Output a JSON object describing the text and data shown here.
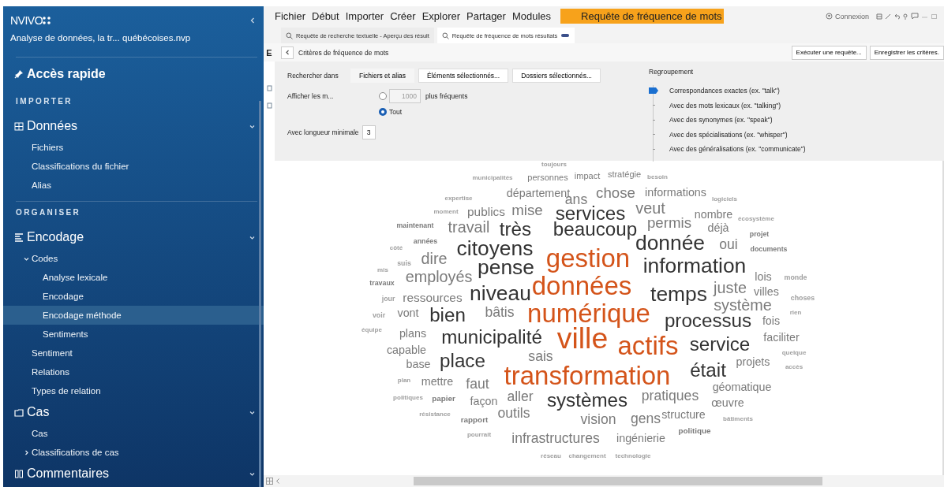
{
  "sidebar": {
    "logo": "NVIVO",
    "project": "Analyse de données, la tr... québécoises.nvp",
    "quick_access": "Accès rapide",
    "sections": [
      {
        "label": "IMPORTER",
        "groups": [
          {
            "label": "Données",
            "expanded": true,
            "children": [
              {
                "label": "Fichiers",
                "selected": false
              },
              {
                "label": "Classifications du fichier",
                "selected": false
              },
              {
                "label": "Alias",
                "selected": false
              }
            ]
          }
        ]
      },
      {
        "label": "ORGANISER",
        "groups": [
          {
            "label": "Encodage",
            "expanded": true,
            "children": [
              {
                "label": "Codes",
                "selected": false,
                "expanded": true,
                "children": [
                  {
                    "label": "Analyse lexicale",
                    "selected": false
                  },
                  {
                    "label": "Encodage",
                    "selected": false
                  },
                  {
                    "label": "Encodage méthode",
                    "selected": true
                  },
                  {
                    "label": "Sentiments",
                    "selected": false
                  }
                ]
              },
              {
                "label": "Sentiment",
                "selected": false
              },
              {
                "label": "Relations",
                "selected": false
              },
              {
                "label": "Types de relation",
                "selected": false
              }
            ]
          },
          {
            "label": "Cas",
            "expanded": true,
            "children": [
              {
                "label": "Cas",
                "selected": false
              },
              {
                "label": "Classifications de cas",
                "selected": false,
                "expanded": false
              }
            ]
          },
          {
            "label": "Commentaires",
            "expanded": true
          }
        ]
      }
    ]
  },
  "menu": [
    {
      "label": "Fichier",
      "kind": "menu"
    },
    {
      "label": "Début",
      "kind": "menu"
    },
    {
      "label": "Importer",
      "kind": "menu"
    },
    {
      "label": "Créer",
      "kind": "menu"
    },
    {
      "label": "Explorer",
      "kind": "menu"
    },
    {
      "label": "Partager",
      "kind": "menu"
    },
    {
      "label": "Modules",
      "kind": "menu"
    },
    {
      "label": "Requête de fréquence de mots",
      "kind": "context"
    }
  ],
  "account": {
    "label": "Connexion"
  },
  "doc_tabs": [
    {
      "label": "Requête de recherche textuelle - Aperçu des résult",
      "selected": false
    },
    {
      "label": "Requête de fréquence de mots résultats",
      "selected": true
    }
  ],
  "left_edge": {
    "label": "E"
  },
  "criteria_bar": {
    "title": "Critères de fréquence de mots",
    "expanded": true,
    "buttons": [
      "Exécuter une requête...",
      "Enregistrer les critères."
    ]
  },
  "criteria": {
    "search_in": {
      "label": "Rechercher dans",
      "options": [
        {
          "label": "Fichiers et alias",
          "selected": true
        },
        {
          "label": "Éléments sélectionnés...",
          "selected": false
        },
        {
          "label": "Dossiers sélectionnés...",
          "selected": false
        }
      ]
    },
    "display": {
      "label": "Afficher les m...",
      "options": [
        {
          "kind": "count",
          "checked": false,
          "value": "1000",
          "disabled": true,
          "suffix": "plus fréquents"
        },
        {
          "kind": "all",
          "checked": true,
          "label": "Tout"
        }
      ]
    },
    "min_length": {
      "label": "Avec longueur minimale",
      "value": "3"
    },
    "grouping": {
      "label": "Regroupement",
      "options": [
        {
          "label": "Correspondances exactes (ex. \"talk\")",
          "selected": true
        },
        {
          "label": "Avec des mots lexicaux (ex. \"talking\")",
          "selected": false
        },
        {
          "label": "Avec des synonymes (ex. \"speak\")",
          "selected": false
        },
        {
          "label": "Avec des spécialisations (ex. \"whisper\")",
          "selected": false
        },
        {
          "label": "Avec des généralisations (ex. \"communicate\")",
          "selected": false
        }
      ]
    }
  },
  "word_cloud": {
    "words": [
      {
        "text": "toujours",
        "color": "#a0a0a0"
      },
      {
        "text": "municipalités",
        "color": "#a0a0a0"
      },
      {
        "text": "personnes",
        "color": "#7a7a7a"
      },
      {
        "text": "impact",
        "color": "#7a7a7a"
      },
      {
        "text": "stratégie",
        "color": "#7a7a7a"
      },
      {
        "text": "besoin",
        "color": "#a0a0a0"
      },
      {
        "text": "expertise",
        "color": "#a0a0a0"
      },
      {
        "text": "département",
        "color": "#7a7a7a"
      },
      {
        "text": "ans",
        "color": "#7a7a7a"
      },
      {
        "text": "chose",
        "color": "#7a7a7a"
      },
      {
        "text": "informations",
        "color": "#7a7a7a"
      },
      {
        "text": "logiciels",
        "color": "#a0a0a0"
      },
      {
        "text": "moment",
        "color": "#a0a0a0"
      },
      {
        "text": "publics",
        "color": "#7a7a7a"
      },
      {
        "text": "mise",
        "color": "#7a7a7a"
      },
      {
        "text": "services",
        "color": "#333333"
      },
      {
        "text": "veut",
        "color": "#7a7a7a"
      },
      {
        "text": "nombre",
        "color": "#7a7a7a"
      },
      {
        "text": "écosystème",
        "color": "#a0a0a0"
      },
      {
        "text": "maintenant",
        "color": "#7a7a7a"
      },
      {
        "text": "travail",
        "color": "#7a7a7a"
      },
      {
        "text": "très",
        "color": "#333333"
      },
      {
        "text": "beaucoup",
        "color": "#333333"
      },
      {
        "text": "permis",
        "color": "#7a7a7a"
      },
      {
        "text": "déjà",
        "color": "#7a7a7a"
      },
      {
        "text": "projet",
        "color": "#7a7a7a"
      },
      {
        "text": "côté",
        "color": "#a0a0a0"
      },
      {
        "text": "années",
        "color": "#7a7a7a"
      },
      {
        "text": "citoyens",
        "color": "#333333"
      },
      {
        "text": "donnée",
        "color": "#333333"
      },
      {
        "text": "oui",
        "color": "#7a7a7a"
      },
      {
        "text": "documents",
        "color": "#7a7a7a"
      },
      {
        "text": "mis",
        "color": "#a0a0a0"
      },
      {
        "text": "suis",
        "color": "#a0a0a0"
      },
      {
        "text": "dire",
        "color": "#7a7a7a"
      },
      {
        "text": "pense",
        "color": "#333333"
      },
      {
        "text": "gestion",
        "color": "#d4541a"
      },
      {
        "text": "information",
        "color": "#333333"
      },
      {
        "text": "travaux",
        "color": "#7a7a7a"
      },
      {
        "text": "employés",
        "color": "#7a7a7a"
      },
      {
        "text": "données",
        "color": "#d4541a"
      },
      {
        "text": "lois",
        "color": "#7a7a7a"
      },
      {
        "text": "monde",
        "color": "#a0a0a0"
      },
      {
        "text": "jour",
        "color": "#a0a0a0"
      },
      {
        "text": "ressources",
        "color": "#7a7a7a"
      },
      {
        "text": "niveau",
        "color": "#333333"
      },
      {
        "text": "temps",
        "color": "#333333"
      },
      {
        "text": "juste",
        "color": "#7a7a7a"
      },
      {
        "text": "système",
        "color": "#7a7a7a"
      },
      {
        "text": "villes",
        "color": "#7a7a7a"
      },
      {
        "text": "choses",
        "color": "#a0a0a0"
      },
      {
        "text": "voir",
        "color": "#a0a0a0"
      },
      {
        "text": "vont",
        "color": "#7a7a7a"
      },
      {
        "text": "bien",
        "color": "#333333"
      },
      {
        "text": "bâtis",
        "color": "#7a7a7a"
      },
      {
        "text": "numérique",
        "color": "#d4541a"
      },
      {
        "text": "processus",
        "color": "#333333"
      },
      {
        "text": "fois",
        "color": "#7a7a7a"
      },
      {
        "text": "rien",
        "color": "#a0a0a0"
      },
      {
        "text": "équipe",
        "color": "#a0a0a0"
      },
      {
        "text": "plans",
        "color": "#7a7a7a"
      },
      {
        "text": "municipalité",
        "color": "#333333"
      },
      {
        "text": "ville",
        "color": "#d4541a"
      },
      {
        "text": "actifs",
        "color": "#d4541a"
      },
      {
        "text": "service",
        "color": "#333333"
      },
      {
        "text": "faciliter",
        "color": "#7a7a7a"
      },
      {
        "text": "capable",
        "color": "#7a7a7a"
      },
      {
        "text": "base",
        "color": "#7a7a7a"
      },
      {
        "text": "place",
        "color": "#333333"
      },
      {
        "text": "sais",
        "color": "#7a7a7a"
      },
      {
        "text": "projets",
        "color": "#7a7a7a"
      },
      {
        "text": "quelque",
        "color": "#a0a0a0"
      },
      {
        "text": "accès",
        "color": "#a0a0a0"
      },
      {
        "text": "plan",
        "color": "#a0a0a0"
      },
      {
        "text": "mettre",
        "color": "#7a7a7a"
      },
      {
        "text": "faut",
        "color": "#7a7a7a"
      },
      {
        "text": "transformation",
        "color": "#d4541a"
      },
      {
        "text": "était",
        "color": "#333333"
      },
      {
        "text": "géomatique",
        "color": "#7a7a7a"
      },
      {
        "text": "politiques",
        "color": "#a0a0a0"
      },
      {
        "text": "papier",
        "color": "#7a7a7a"
      },
      {
        "text": "façon",
        "color": "#7a7a7a"
      },
      {
        "text": "aller",
        "color": "#7a7a7a"
      },
      {
        "text": "systèmes",
        "color": "#333333"
      },
      {
        "text": "pratiques",
        "color": "#7a7a7a"
      },
      {
        "text": "œuvre",
        "color": "#7a7a7a"
      },
      {
        "text": "résistance",
        "color": "#a0a0a0"
      },
      {
        "text": "rapport",
        "color": "#7a7a7a"
      },
      {
        "text": "outils",
        "color": "#7a7a7a"
      },
      {
        "text": "vision",
        "color": "#7a7a7a"
      },
      {
        "text": "gens",
        "color": "#7a7a7a"
      },
      {
        "text": "structure",
        "color": "#7a7a7a"
      },
      {
        "text": "bâtiments",
        "color": "#a0a0a0"
      },
      {
        "text": "pourrait",
        "color": "#a0a0a0"
      },
      {
        "text": "infrastructures",
        "color": "#7a7a7a"
      },
      {
        "text": "ingénierie",
        "color": "#7a7a7a"
      },
      {
        "text": "politique",
        "color": "#7a7a7a"
      },
      {
        "text": "réseau",
        "color": "#a0a0a0"
      },
      {
        "text": "changement",
        "color": "#a0a0a0"
      },
      {
        "text": "technologie",
        "color": "#a0a0a0"
      }
    ]
  }
}
